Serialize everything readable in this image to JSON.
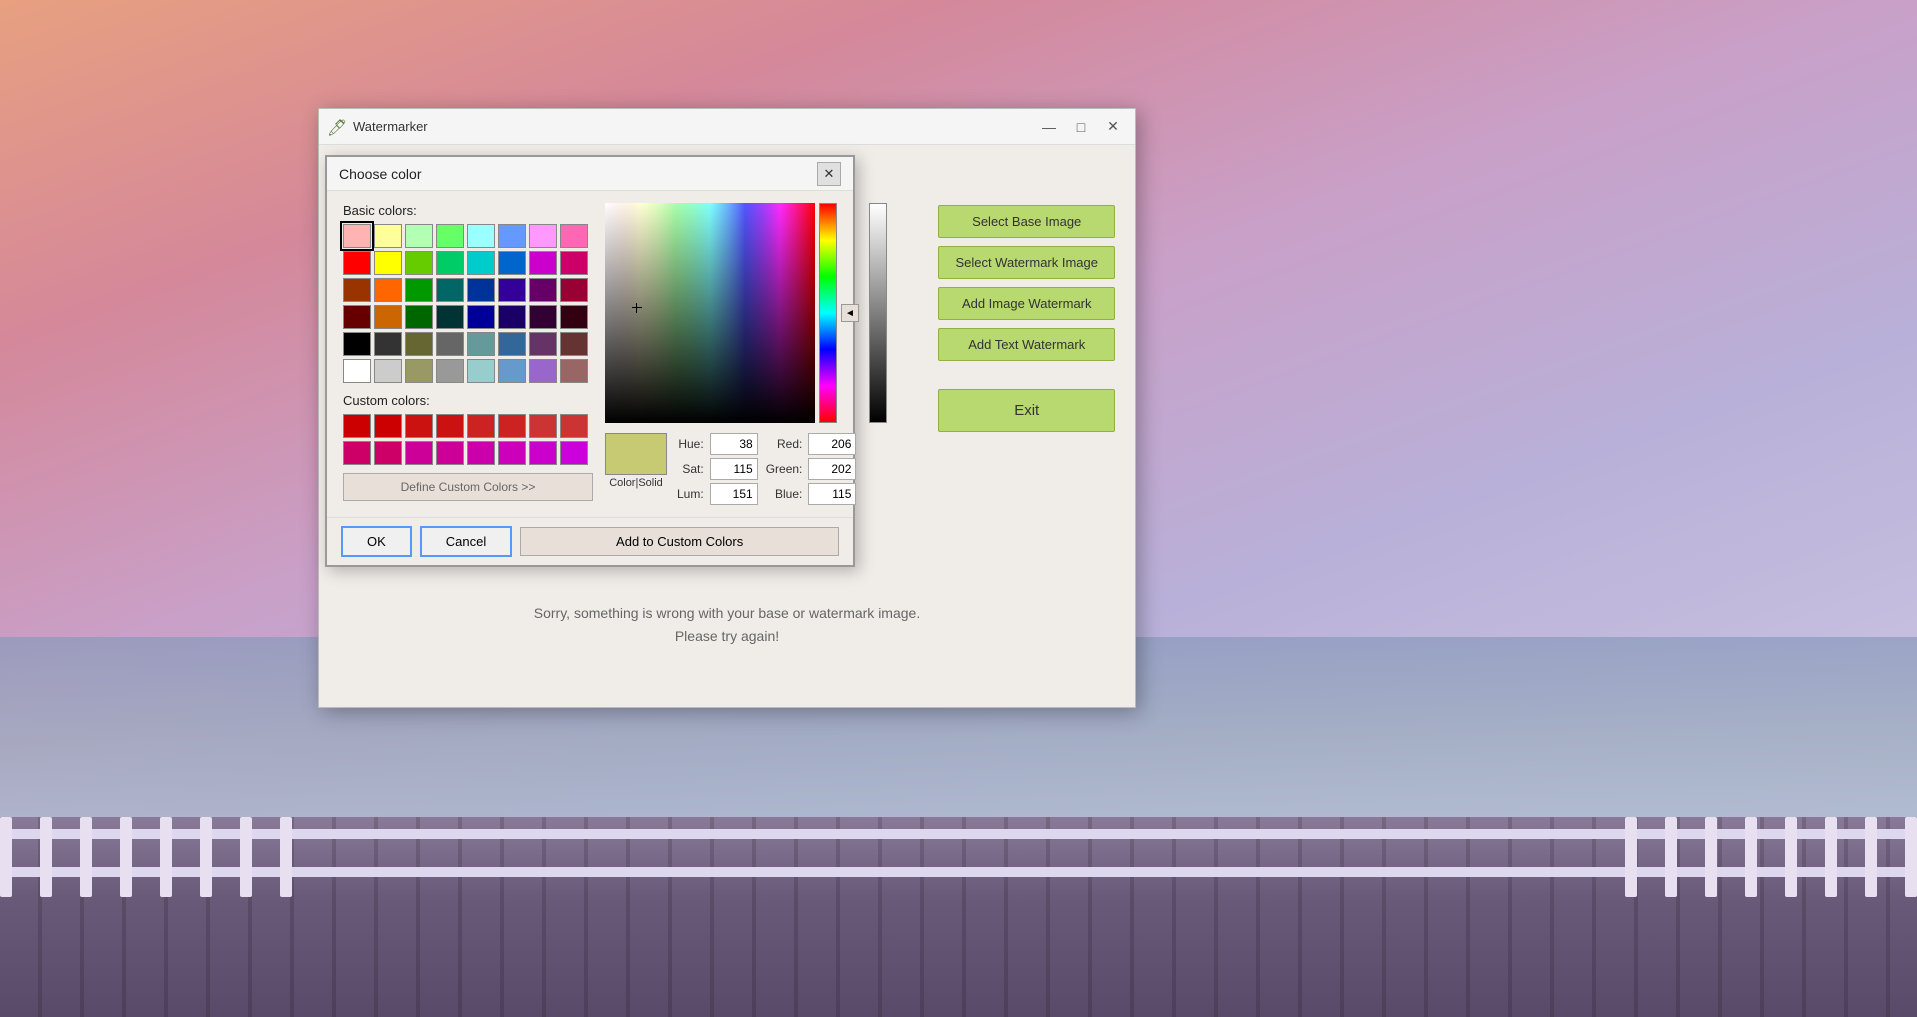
{
  "background": {
    "description": "Sunset pier background"
  },
  "app_window": {
    "title": "Watermarker",
    "icon": "🖊",
    "title_controls": {
      "minimize": "—",
      "maximize": "□",
      "close": "✕"
    },
    "side_buttons": {
      "select_base": "Select Base Image",
      "select_watermark": "Select Watermark Image",
      "add_image": "Add Image Watermark",
      "add_text": "Add Text Watermark",
      "exit": "Exit"
    },
    "error_message_line1": "Sorry, something is wrong with your base or watermark image.",
    "error_message_line2": "Please try again!"
  },
  "color_dialog": {
    "title": "Choose color",
    "close": "✕",
    "basic_colors_label": "Basic colors:",
    "custom_colors_label": "Custom colors:",
    "define_custom_btn": "Define Custom Colors >>",
    "add_custom_btn": "Add to Custom Colors",
    "ok_btn": "OK",
    "cancel_btn": "Cancel",
    "color_label": "Color|Solid",
    "hue": {
      "label": "Hue:",
      "value": "38"
    },
    "sat": {
      "label": "Sat:",
      "value": "115"
    },
    "lum": {
      "label": "Lum:",
      "value": "151"
    },
    "red": {
      "label": "Red:",
      "value": "206"
    },
    "green": {
      "label": "Green:",
      "value": "202"
    },
    "blue": {
      "label": "Blue:",
      "value": "115"
    },
    "basic_colors": [
      "#ffb3b3",
      "#ffff99",
      "#b3ffb3",
      "#66ff66",
      "#99ffff",
      "#6699ff",
      "#ff99ff",
      "#ff66b3",
      "#ff0000",
      "#ffff00",
      "#66cc00",
      "#00cc66",
      "#00cccc",
      "#0066cc",
      "#cc00cc",
      "#cc0066",
      "#993300",
      "#ff6600",
      "#009900",
      "#006666",
      "#003399",
      "#330099",
      "#660066",
      "#990033",
      "#660000",
      "#cc6600",
      "#006600",
      "#003333",
      "#000099",
      "#1a0066",
      "#330033",
      "#330011",
      "#000000",
      "#333333",
      "#666633",
      "#666666",
      "#669999",
      "#336699",
      "#663366",
      "#663333",
      "#ffffff",
      "#cccccc",
      "#999966",
      "#999999",
      "#99cccc",
      "#6699cc",
      "#9966cc",
      "#996666"
    ],
    "custom_colors": [
      "#cc0000",
      "#cc0000",
      "#cc1111",
      "#cc1111",
      "#cc2222",
      "#cc2222",
      "#cc3333",
      "#cc3333",
      "#cc0066",
      "#cc0066",
      "#cc0099",
      "#cc0099",
      "#cc00aa",
      "#cc00bb",
      "#cc00cc",
      "#cc00dd"
    ],
    "preview_color": "#c8ca73"
  }
}
